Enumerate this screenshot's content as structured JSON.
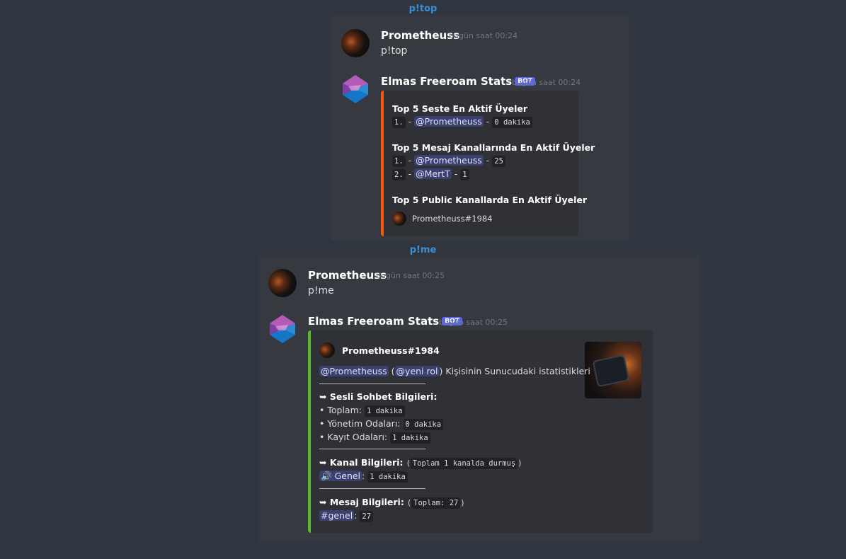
{
  "sections": [
    {
      "caption": "p!top",
      "user_msg": {
        "username": "Prometheuss",
        "timestamp": "bugün saat 00:24",
        "text": "p!top"
      },
      "bot_msg": {
        "username": "Elmas Freeroam Stats",
        "badge": "BOT",
        "timestamp": "bugün saat 00:24",
        "embed": {
          "accent": "#f0590f",
          "voice_title": "Top 5 Seste En Aktif Üyeler",
          "voice_rows": [
            {
              "rank": "1.",
              "sep": "-",
              "mention": "@Prometheuss",
              "dash": "-",
              "value": "0 dakika"
            }
          ],
          "msg_title": "Top 5 Mesaj Kanallarında En Aktif Üyeler",
          "msg_rows": [
            {
              "rank": "1.",
              "sep": "-",
              "mention": "@Prometheuss",
              "dash": "-",
              "value": "25"
            },
            {
              "rank": "2.",
              "sep": "-",
              "mention": "@MertT",
              "dash": "-",
              "value": "1"
            }
          ],
          "public_title": "Top 5 Public Kanallarda En Aktif Üyeler",
          "footer": "Prometheuss#1984"
        }
      }
    },
    {
      "caption": "p!me",
      "user_msg": {
        "username": "Prometheuss",
        "timestamp": "bugün saat 00:25",
        "text": "p!me"
      },
      "bot_msg": {
        "username": "Elmas Freeroam Stats",
        "badge": "BOT",
        "timestamp": "bugün saat 00:25",
        "embed": {
          "accent": "#57c026",
          "author": "Prometheuss#1984",
          "desc_mention": "@Prometheuss",
          "desc_paren_open": "(",
          "desc_role": "@yeni rol",
          "desc_paren_close": ")",
          "desc_text": "Kişisinin Sunucudaki istatistikleri",
          "arrow": "➥",
          "voice_title": "Sesli Sohbet Bilgileri:",
          "voice_items": [
            {
              "bullet": "•",
              "label": "Toplam:",
              "value": "1 dakika"
            },
            {
              "bullet": "•",
              "label": "Yönetim Odaları:",
              "value": "0 dakika"
            },
            {
              "bullet": "•",
              "label": "Kayıt Odaları:",
              "value": "1 dakika"
            }
          ],
          "channel_title": "Kanal Bilgileri:",
          "channel_note": "Toplam 1 kanalda durmuş",
          "channel_name": "Genel",
          "channel_colon": ":",
          "channel_value": "1 dakika",
          "message_title": "Mesaj Bilgileri:",
          "message_note": "Toplam: 27",
          "text_channel": "genel",
          "text_colon": ":",
          "text_value": "27"
        }
      }
    }
  ]
}
